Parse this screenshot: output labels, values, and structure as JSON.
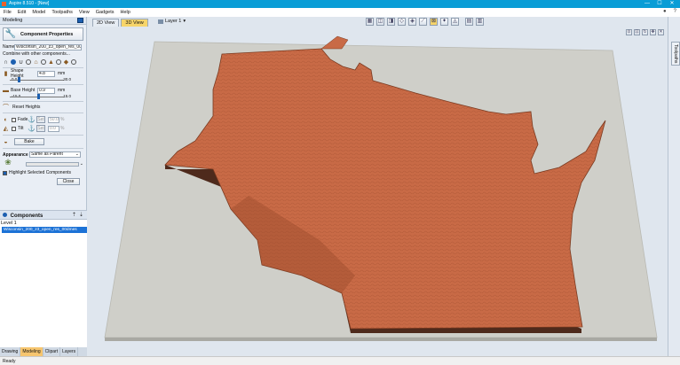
{
  "window": {
    "title": "Aspire 8.510 - [New]",
    "controls": [
      "—",
      "☐",
      "✕"
    ]
  },
  "menu": {
    "items": [
      "File",
      "Edit",
      "Model",
      "Toolpaths",
      "View",
      "Gadgets",
      "Help"
    ],
    "right_icons": [
      "circle-icon",
      "help-icon"
    ]
  },
  "left_panel": {
    "header": "Modeling",
    "component_properties": {
      "title": "Component Properties",
      "name_label": "Name",
      "name_value": "Wisconsin_200_z3_open_res_00(",
      "combine_label": "Combine with other components...",
      "shape_height_label": "Shape Height",
      "shape_height_value": "4.8",
      "shape_height_unit": "mm",
      "shape_slider_min": "0.0",
      "shape_slider_max": "30.0",
      "shape_slider_level": 0.16,
      "base_height_label": "Base Height",
      "base_height_value": "0.9",
      "base_height_unit": "mm",
      "base_slider_min": "-15.0",
      "base_slider_max": "15.0",
      "base_slider_level": 0.53,
      "reset_heights": "Reset Heights",
      "fade_label": "Fade",
      "fade_set": "Set",
      "fade_value": "50.0",
      "fade_unit": "%",
      "tilt_label": "Tilt",
      "tilt_set": "Set",
      "tilt_value": "0.0",
      "tilt_unit": "%",
      "bake_label": "Bake",
      "appearance_label": "Appearance",
      "appearance_value": "Same as Parent",
      "highlight_label": "Highlight Selected Components",
      "close_label": "Close"
    },
    "components": {
      "header": "Components",
      "level_label": "Level 1",
      "items": [
        "Wisconsin_200_z3_open_res_00dmes"
      ]
    },
    "bottom_tabs": [
      {
        "label": "Drawing",
        "active": false
      },
      {
        "label": "Modeling",
        "active": true
      },
      {
        "label": "Clipart",
        "active": false
      },
      {
        "label": "Layers",
        "active": false
      }
    ]
  },
  "view": {
    "tabs": [
      {
        "label": "2D View",
        "active": false
      },
      {
        "label": "3D View",
        "active": true
      }
    ],
    "layer_label": "Layer 1",
    "toolbar_icons": [
      "grid-icon",
      "view-top-icon",
      "view-iso-icon",
      "diamond-icon",
      "shade-icon",
      "measure-icon",
      "select-icon",
      "model-icon",
      "pyramid-icon",
      "tile-icon",
      "layout-icon"
    ],
    "view_icons": [
      "zoom-icon",
      "fit-icon",
      "rotate-icon",
      "pan-icon",
      "close-icon"
    ],
    "right_panel_tab": "Toolpaths"
  },
  "colors": {
    "title_bar": "#0a9dd6",
    "terrain": "#c86a46",
    "plate": "#cfcfc9",
    "active_tab": "#f7d56a"
  },
  "status": {
    "text": "Ready"
  }
}
